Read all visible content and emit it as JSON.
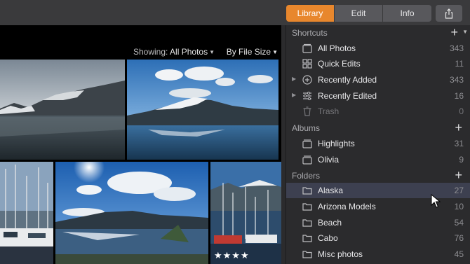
{
  "toolbar": {
    "tabs": [
      "Library",
      "Edit",
      "Info"
    ],
    "active_tab": "Library",
    "share_icon": "share-icon"
  },
  "filter": {
    "showing_label": "Showing:",
    "showing_value": "All Photos",
    "sort_value": "By File Size"
  },
  "photos": {
    "rating_stars": "★★★★"
  },
  "sidebar": {
    "shortcuts": {
      "title": "Shortcuts",
      "items": [
        {
          "label": "All Photos",
          "count": "343",
          "icon": "folder-icon"
        },
        {
          "label": "Quick Edits",
          "count": "11",
          "icon": "grid-icon"
        },
        {
          "label": "Recently Added",
          "count": "343",
          "icon": "add-circle-icon"
        },
        {
          "label": "Recently Edited",
          "count": "16",
          "icon": "sliders-icon"
        },
        {
          "label": "Trash",
          "count": "0",
          "icon": "trash-icon"
        }
      ]
    },
    "albums": {
      "title": "Albums",
      "items": [
        {
          "label": "Highlights",
          "count": "31"
        },
        {
          "label": "Olivia",
          "count": "9"
        }
      ]
    },
    "folders": {
      "title": "Folders",
      "items": [
        {
          "label": "Alaska",
          "count": "27"
        },
        {
          "label": "Arizona Models",
          "count": "10"
        },
        {
          "label": "Beach",
          "count": "54"
        },
        {
          "label": "Cabo",
          "count": "76"
        },
        {
          "label": "Misc photos",
          "count": "45"
        }
      ]
    }
  },
  "colors": {
    "accent": "#e8872d",
    "sidebar_bg": "#2b2b2d",
    "selection": "#3d4050"
  }
}
